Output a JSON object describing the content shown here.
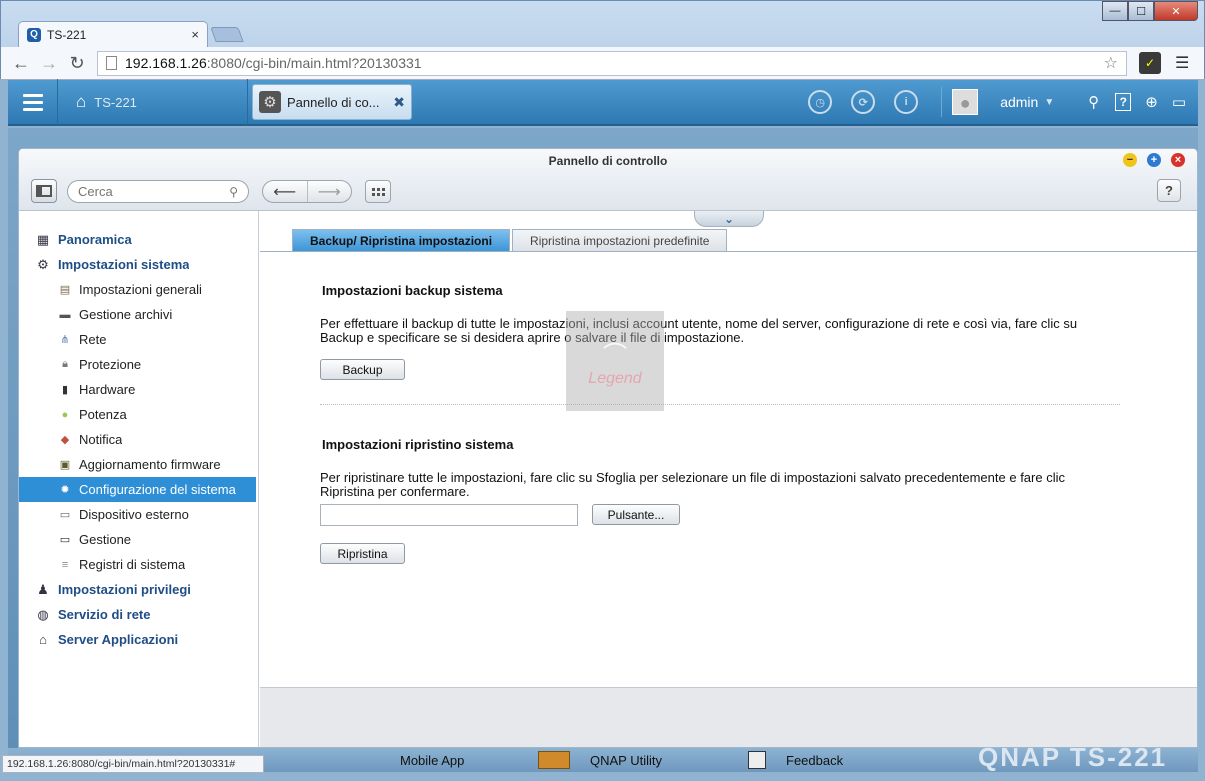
{
  "browser": {
    "tab_title": "TS-221",
    "tab_close": "×",
    "url_host": "192.168.1.26",
    "url_rest": ":8080/cgi-bin/main.html?20130331",
    "status_url": "192.168.1.26:8080/cgi-bin/main.html?20130331#"
  },
  "qts": {
    "home_label": "TS-221",
    "app_tab_label": "Pannello di co...",
    "user": "admin"
  },
  "window": {
    "title": "Pannello di controllo",
    "search_placeholder": "Cerca"
  },
  "sidebar": {
    "items": [
      {
        "label": "Panoramica",
        "level": "top",
        "icon": "overview-icon"
      },
      {
        "label": "Impostazioni sistema",
        "level": "top",
        "icon": "gear-icon"
      },
      {
        "label": "Impostazioni generali",
        "level": "sub",
        "icon": "general-settings-icon"
      },
      {
        "label": "Gestione archivi",
        "level": "sub",
        "icon": "storage-icon"
      },
      {
        "label": "Rete",
        "level": "sub",
        "icon": "network-icon"
      },
      {
        "label": "Protezione",
        "level": "sub",
        "icon": "lock-icon"
      },
      {
        "label": "Hardware",
        "level": "sub",
        "icon": "hardware-icon"
      },
      {
        "label": "Potenza",
        "level": "sub",
        "icon": "bulb-icon"
      },
      {
        "label": "Notifica",
        "level": "sub",
        "icon": "notification-icon"
      },
      {
        "label": "Aggiornamento firmware",
        "level": "sub",
        "icon": "firmware-icon"
      },
      {
        "label": "Configurazione del sistema",
        "level": "sub",
        "icon": "system-config-icon",
        "active": true
      },
      {
        "label": "Dispositivo esterno",
        "level": "sub",
        "icon": "external-device-icon"
      },
      {
        "label": "Gestione",
        "level": "sub",
        "icon": "monitor-icon"
      },
      {
        "label": "Registri di sistema",
        "level": "sub",
        "icon": "log-icon"
      },
      {
        "label": "Impostazioni privilegi",
        "level": "top",
        "icon": "user-icon"
      },
      {
        "label": "Servizio di rete",
        "level": "top",
        "icon": "globe-icon"
      },
      {
        "label": "Server Applicazioni",
        "level": "top",
        "icon": "app-server-icon"
      }
    ]
  },
  "tabs": {
    "active": "Backup/ Ripristina impostazioni",
    "inactive": "Ripristina impostazioni predefinite"
  },
  "backup": {
    "title": "Impostazioni backup sistema",
    "description": "Per effettuare il backup di tutte le impostazioni, inclusi account utente, nome del server, configurazione di rete e così via, fare clic su Backup e specificare se si desidera aprire o salvare il file di impostazione.",
    "button": "Backup"
  },
  "restore": {
    "title": "Impostazioni ripristino sistema",
    "description": "Per ripristinare tutte le impostazioni, fare clic su Sfoglia per selezionare un file di impostazioni salvato precedentemente e fare clic Ripristina per confermare.",
    "browse_button": "Pulsante...",
    "restore_button": "Ripristina"
  },
  "watermark": {
    "sub": "Legend"
  },
  "taskbar": {
    "mobile_app": "Mobile App",
    "utility": "QNAP Utility",
    "feedback": "Feedback",
    "brand": "QNAP TS-221"
  },
  "colors": {
    "qts_bar": "#3a87c2",
    "active_item": "#2f8fd6",
    "category_text": "#1f4d86"
  }
}
